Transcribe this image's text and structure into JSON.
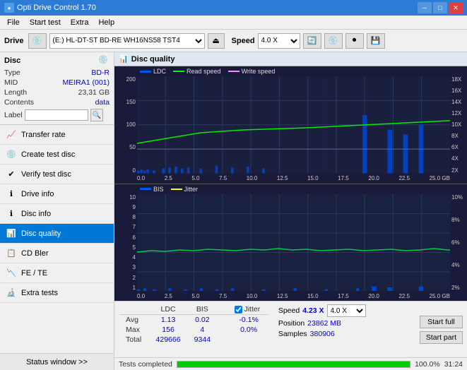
{
  "titlebar": {
    "title": "Opti Drive Control 1.70",
    "icon": "●",
    "minimize": "─",
    "maximize": "□",
    "close": "✕"
  },
  "menubar": {
    "items": [
      "File",
      "Start test",
      "Extra",
      "Help"
    ]
  },
  "toolbar": {
    "drive_label": "Drive",
    "drive_value": "(E:)  HL-DT-ST BD-RE  WH16NS58 TST4",
    "speed_label": "Speed",
    "speed_value": "4.0 X"
  },
  "sidebar": {
    "disc_label": "Disc",
    "disc_fields": [
      {
        "key": "Type",
        "value": "BD-R"
      },
      {
        "key": "MID",
        "value": "MEIRA1 (001)"
      },
      {
        "key": "Length",
        "value": "23,31 GB"
      },
      {
        "key": "Contents",
        "value": "data"
      },
      {
        "key": "Label",
        "value": ""
      }
    ],
    "nav_items": [
      {
        "id": "transfer-rate",
        "label": "Transfer rate",
        "icon": "📈"
      },
      {
        "id": "create-test-disc",
        "label": "Create test disc",
        "icon": "💿"
      },
      {
        "id": "verify-test-disc",
        "label": "Verify test disc",
        "icon": "✔"
      },
      {
        "id": "drive-info",
        "label": "Drive info",
        "icon": "ℹ"
      },
      {
        "id": "disc-info",
        "label": "Disc info",
        "icon": "ℹ"
      },
      {
        "id": "disc-quality",
        "label": "Disc quality",
        "icon": "📊",
        "active": true
      },
      {
        "id": "cd-bler",
        "label": "CD Bler",
        "icon": "📋"
      },
      {
        "id": "fe-te",
        "label": "FE / TE",
        "icon": "📉"
      },
      {
        "id": "extra-tests",
        "label": "Extra tests",
        "icon": "🔬"
      }
    ],
    "status_window": "Status window >>"
  },
  "quality": {
    "title": "Disc quality",
    "legend": {
      "ldc": {
        "label": "LDC",
        "color": "#0066ff"
      },
      "read_speed": {
        "label": "Read speed",
        "color": "#00ff00"
      },
      "write_speed": {
        "label": "Write speed",
        "color": "#ff66ff"
      }
    },
    "legend2": {
      "bis": {
        "label": "BIS",
        "color": "#0066ff"
      },
      "jitter": {
        "label": "Jitter",
        "color": "#ffff00"
      }
    },
    "chart_top": {
      "y_labels_left": [
        "200",
        "150",
        "100",
        "50",
        "0"
      ],
      "y_labels_right": [
        "18X",
        "16X",
        "14X",
        "12X",
        "10X",
        "8X",
        "6X",
        "4X",
        "2X"
      ],
      "x_labels": [
        "0.0",
        "2.5",
        "5.0",
        "7.5",
        "10.0",
        "12.5",
        "15.0",
        "17.5",
        "20.0",
        "22.5",
        "25.0 GB"
      ]
    },
    "chart_bottom": {
      "y_labels_left": [
        "10",
        "9",
        "8",
        "7",
        "6",
        "5",
        "4",
        "3",
        "2",
        "1"
      ],
      "y_labels_right": [
        "10%",
        "8%",
        "6%",
        "4%",
        "2%"
      ],
      "x_labels": [
        "0.0",
        "2.5",
        "5.0",
        "7.5",
        "10.0",
        "12.5",
        "15.0",
        "17.5",
        "20.0",
        "22.5",
        "25.0 GB"
      ]
    }
  },
  "stats": {
    "columns": [
      "LDC",
      "BIS",
      "",
      "Jitter",
      "Speed",
      ""
    ],
    "rows": [
      {
        "label": "Avg",
        "ldc": "1.13",
        "bis": "0.02",
        "jitter": "-0.1%",
        "speed_label": "Position",
        "speed_val": "4.23 X",
        "speed_sel": "4.0 X",
        "pos_val": "23862 MB"
      },
      {
        "label": "Max",
        "ldc": "156",
        "bis": "4",
        "jitter": "0.0%",
        "samples_label": "Samples",
        "samples_val": "380906"
      },
      {
        "label": "Total",
        "ldc": "429666",
        "bis": "9344",
        "jitter": ""
      }
    ],
    "jitter_checked": true,
    "jitter_label": "Jitter",
    "speed_label": "Speed",
    "speed_val": "4.23 X",
    "speed_sel": "4.0 X",
    "position_label": "Position",
    "position_val": "23862 MB",
    "samples_label": "Samples",
    "samples_val": "380906",
    "btn_start_full": "Start full",
    "btn_start_part": "Start part"
  },
  "bottombar": {
    "status": "Tests completed",
    "progress": 100,
    "time": "31:24"
  }
}
